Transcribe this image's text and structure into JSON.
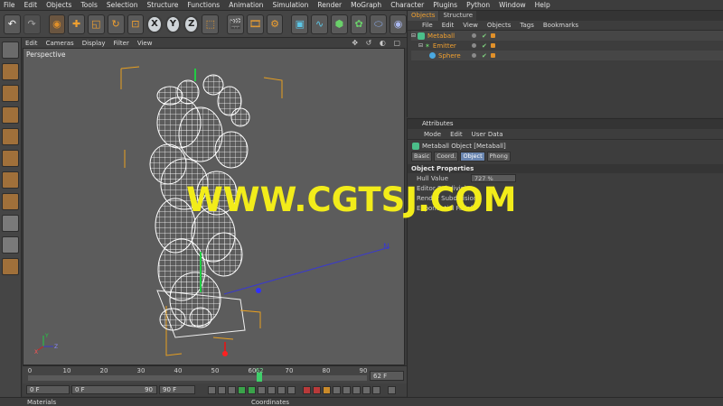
{
  "menubar": [
    "File",
    "Edit",
    "Objects",
    "Tools",
    "Selection",
    "Structure",
    "Functions",
    "Animation",
    "Simulation",
    "Render",
    "MoGraph",
    "Character",
    "Plugins",
    "Python",
    "Window",
    "Help"
  ],
  "toolbar": {
    "axis_x": "X",
    "axis_y": "Y",
    "axis_z": "Z"
  },
  "viewport": {
    "menu": [
      "Edit",
      "Cameras",
      "Display",
      "Filter",
      "View"
    ],
    "label": "Perspective",
    "nav": "✥ ↺ ◐ ▢"
  },
  "watermark": "WWW.CGTSJ.COM",
  "timeline": {
    "ticks": [
      "0",
      "10",
      "20",
      "30",
      "40",
      "50",
      "60",
      "62",
      "70",
      "80",
      "90"
    ],
    "current_frame": 62,
    "end_frame_label": "62 F",
    "max": 90
  },
  "transport": {
    "start": "0 F",
    "current": "0 F",
    "current_right": "90",
    "end": "90 F"
  },
  "bottom": {
    "materials": "Materials",
    "coordinates": "Coordinates"
  },
  "objects_panel": {
    "tabs": [
      "Objects",
      "Structure"
    ],
    "menu": [
      "File",
      "Edit",
      "View",
      "Objects",
      "Tags",
      "Bookmarks"
    ],
    "items": [
      {
        "name": "Metaball"
      },
      {
        "name": "Emitter"
      },
      {
        "name": "Sphere"
      }
    ]
  },
  "attributes": {
    "title": "Attributes",
    "menu": [
      "Mode",
      "Edit",
      "User Data"
    ],
    "object_name": "Metaball Object [Metaball]",
    "tabs": [
      "Basic",
      "Coord.",
      "Object",
      "Phong"
    ],
    "active_tab": "Object",
    "section": "Object Properties",
    "props": {
      "hull_label": "Hull Value",
      "hull_value": "727 %",
      "editor_label": "Editor Subdivision",
      "render_label": "Render Subdivision",
      "exp_label": "Exponential Falloff"
    }
  },
  "colors": {
    "accent": "#f0a030",
    "watermark": "#f2ec1a",
    "playhead": "#3ed06a",
    "wire": "#ffffff",
    "bbox": "#e8a020"
  }
}
